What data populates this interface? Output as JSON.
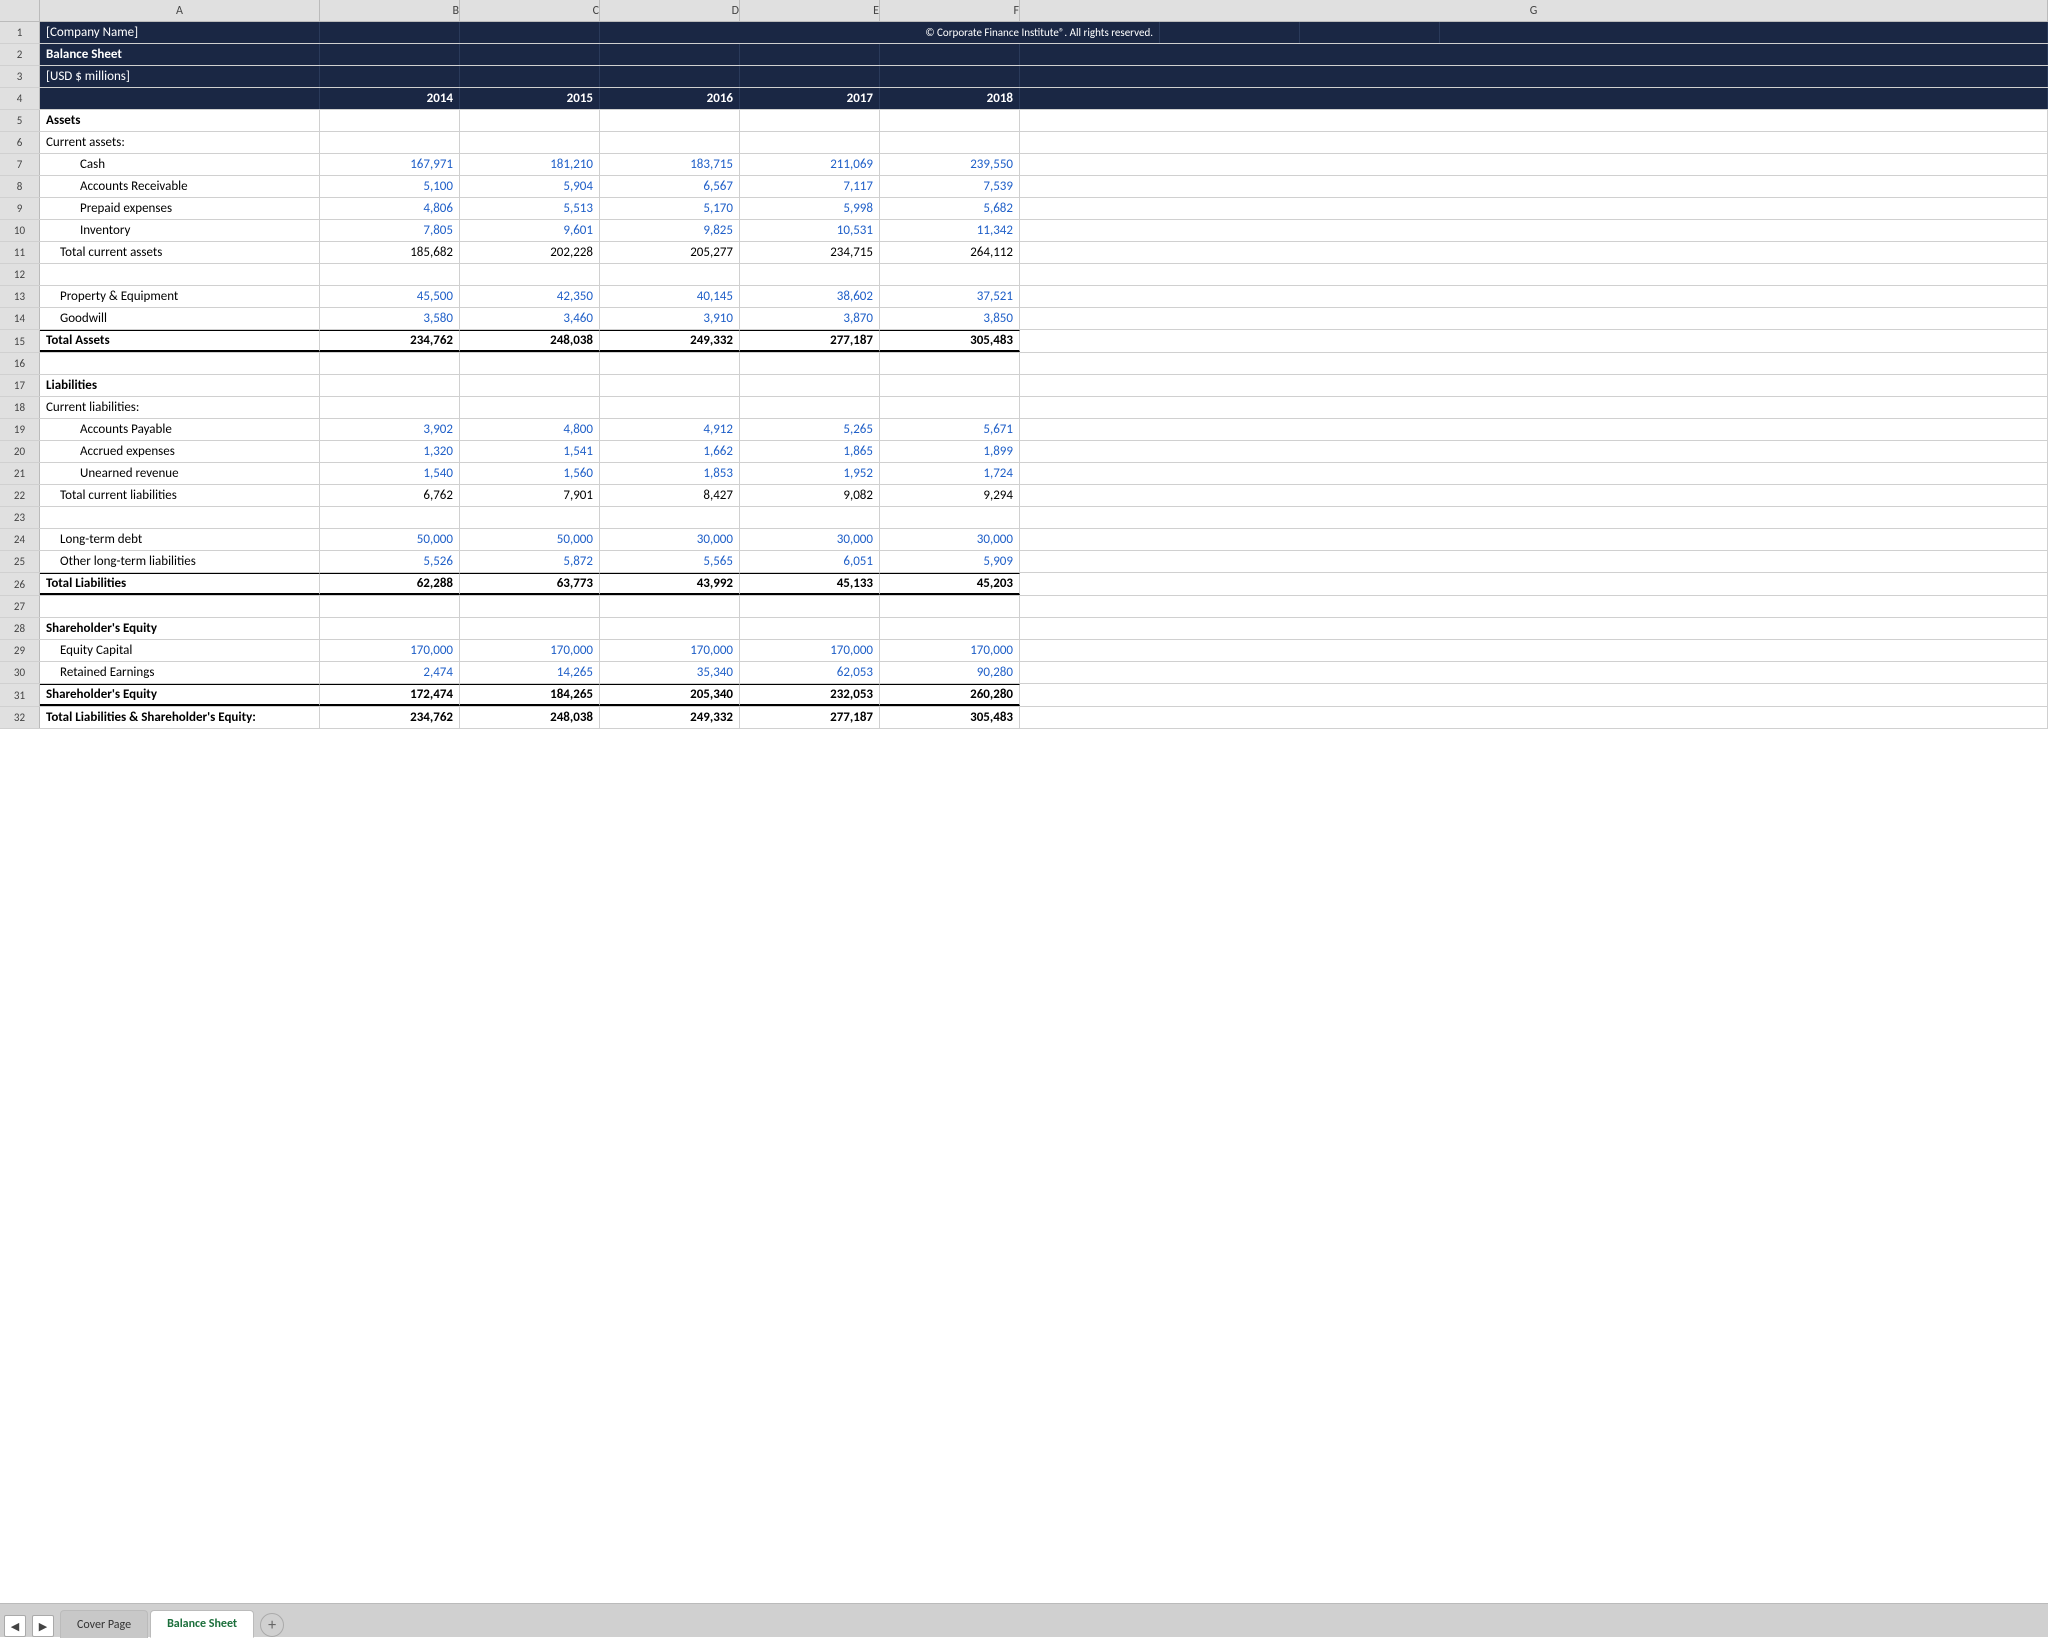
{
  "columns": {
    "headers": [
      "",
      "A",
      "B",
      "C",
      "D",
      "E",
      "F",
      "G"
    ]
  },
  "rows": [
    {
      "num": "1",
      "a": "[Company Name]",
      "b": "",
      "c": "",
      "d": "© Corporate Finance Institute®. All rights reserved.",
      "e": "",
      "f": "",
      "g": "",
      "style": "header-dark",
      "bold": false,
      "copyright": true
    },
    {
      "num": "2",
      "a": "Balance Sheet",
      "b": "",
      "c": "",
      "d": "",
      "e": "",
      "f": "",
      "g": "",
      "style": "header-dark",
      "bold": true
    },
    {
      "num": "3",
      "a": "[USD $ millions]",
      "b": "",
      "c": "",
      "d": "",
      "e": "",
      "f": "",
      "g": "",
      "style": "header-dark",
      "bold": false
    },
    {
      "num": "4",
      "a": "",
      "b": "2014",
      "c": "2015",
      "d": "2016",
      "e": "2017",
      "f": "2018",
      "g": "",
      "style": "year-header",
      "bold": true
    },
    {
      "num": "5",
      "a": "Assets",
      "b": "",
      "c": "",
      "d": "",
      "e": "",
      "f": "",
      "g": "",
      "style": "normal",
      "bold": true
    },
    {
      "num": "6",
      "a": "Current assets:",
      "b": "",
      "c": "",
      "d": "",
      "e": "",
      "f": "",
      "g": "",
      "style": "normal",
      "bold": false
    },
    {
      "num": "7",
      "a": "Cash",
      "b": "167,971",
      "c": "181,210",
      "d": "183,715",
      "e": "211,069",
      "f": "239,550",
      "g": "",
      "style": "normal",
      "blue": true,
      "indent": "indent-2"
    },
    {
      "num": "8",
      "a": "Accounts Receivable",
      "b": "5,100",
      "c": "5,904",
      "d": "6,567",
      "e": "7,117",
      "f": "7,539",
      "g": "",
      "style": "normal",
      "blue": true,
      "indent": "indent-2"
    },
    {
      "num": "9",
      "a": "Prepaid expenses",
      "b": "4,806",
      "c": "5,513",
      "d": "5,170",
      "e": "5,998",
      "f": "5,682",
      "g": "",
      "style": "normal",
      "blue": true,
      "indent": "indent-2"
    },
    {
      "num": "10",
      "a": "Inventory",
      "b": "7,805",
      "c": "9,601",
      "d": "9,825",
      "e": "10,531",
      "f": "11,342",
      "g": "",
      "style": "normal",
      "blue": true,
      "indent": "indent-2"
    },
    {
      "num": "11",
      "a": "Total current assets",
      "b": "185,682",
      "c": "202,228",
      "d": "205,277",
      "e": "234,715",
      "f": "264,112",
      "g": "",
      "style": "subtotal",
      "indent": "indent-1"
    },
    {
      "num": "12",
      "a": "",
      "b": "",
      "c": "",
      "d": "",
      "e": "",
      "f": "",
      "g": "",
      "style": "normal"
    },
    {
      "num": "13",
      "a": "Property & Equipment",
      "b": "45,500",
      "c": "42,350",
      "d": "40,145",
      "e": "38,602",
      "f": "37,521",
      "g": "",
      "style": "normal",
      "blue": true,
      "indent": "indent-1"
    },
    {
      "num": "14",
      "a": "Goodwill",
      "b": "3,580",
      "c": "3,460",
      "d": "3,910",
      "e": "3,870",
      "f": "3,850",
      "g": "",
      "style": "normal",
      "blue": true,
      "indent": "indent-1"
    },
    {
      "num": "15",
      "a": "Total Assets",
      "b": "234,762",
      "c": "248,038",
      "d": "249,332",
      "e": "277,187",
      "f": "305,483",
      "g": "",
      "style": "total",
      "bold": true
    },
    {
      "num": "16",
      "a": "",
      "b": "",
      "c": "",
      "d": "",
      "e": "",
      "f": "",
      "g": "",
      "style": "normal"
    },
    {
      "num": "17",
      "a": "Liabilities",
      "b": "",
      "c": "",
      "d": "",
      "e": "",
      "f": "",
      "g": "",
      "style": "normal",
      "bold": true
    },
    {
      "num": "18",
      "a": "Current liabilities:",
      "b": "",
      "c": "",
      "d": "",
      "e": "",
      "f": "",
      "g": "",
      "style": "normal"
    },
    {
      "num": "19",
      "a": "Accounts Payable",
      "b": "3,902",
      "c": "4,800",
      "d": "4,912",
      "e": "5,265",
      "f": "5,671",
      "g": "",
      "style": "normal",
      "blue": true,
      "indent": "indent-2"
    },
    {
      "num": "20",
      "a": "Accrued expenses",
      "b": "1,320",
      "c": "1,541",
      "d": "1,662",
      "e": "1,865",
      "f": "1,899",
      "g": "",
      "style": "normal",
      "blue": true,
      "indent": "indent-2"
    },
    {
      "num": "21",
      "a": "Unearned revenue",
      "b": "1,540",
      "c": "1,560",
      "d": "1,853",
      "e": "1,952",
      "f": "1,724",
      "g": "",
      "style": "normal",
      "blue": true,
      "indent": "indent-2"
    },
    {
      "num": "22",
      "a": "Total current liabilities",
      "b": "6,762",
      "c": "7,901",
      "d": "8,427",
      "e": "9,082",
      "f": "9,294",
      "g": "",
      "style": "subtotal",
      "indent": "indent-1"
    },
    {
      "num": "23",
      "a": "",
      "b": "",
      "c": "",
      "d": "",
      "e": "",
      "f": "",
      "g": "",
      "style": "normal"
    },
    {
      "num": "24",
      "a": "Long-term debt",
      "b": "50,000",
      "c": "50,000",
      "d": "30,000",
      "e": "30,000",
      "f": "30,000",
      "g": "",
      "style": "normal",
      "blue": true,
      "indent": "indent-1"
    },
    {
      "num": "25",
      "a": "Other long-term liabilities",
      "b": "5,526",
      "c": "5,872",
      "d": "5,565",
      "e": "6,051",
      "f": "5,909",
      "g": "",
      "style": "normal",
      "blue": true,
      "indent": "indent-1"
    },
    {
      "num": "26",
      "a": "Total Liabilities",
      "b": "62,288",
      "c": "63,773",
      "d": "43,992",
      "e": "45,133",
      "f": "45,203",
      "g": "",
      "style": "total",
      "bold": true
    },
    {
      "num": "27",
      "a": "",
      "b": "",
      "c": "",
      "d": "",
      "e": "",
      "f": "",
      "g": "",
      "style": "normal"
    },
    {
      "num": "28",
      "a": "Shareholder's Equity",
      "b": "",
      "c": "",
      "d": "",
      "e": "",
      "f": "",
      "g": "",
      "style": "normal",
      "bold": true
    },
    {
      "num": "29",
      "a": "Equity Capital",
      "b": "170,000",
      "c": "170,000",
      "d": "170,000",
      "e": "170,000",
      "f": "170,000",
      "g": "",
      "style": "normal",
      "blue": true,
      "indent": "indent-1"
    },
    {
      "num": "30",
      "a": "Retained Earnings",
      "b": "2,474",
      "c": "14,265",
      "d": "35,340",
      "e": "62,053",
      "f": "90,280",
      "g": "",
      "style": "normal",
      "blue": true,
      "indent": "indent-1"
    },
    {
      "num": "31",
      "a": "Shareholder's Equity",
      "b": "172,474",
      "c": "184,265",
      "d": "205,340",
      "e": "232,053",
      "f": "260,280",
      "g": "",
      "style": "total",
      "bold": true
    },
    {
      "num": "32",
      "a": "Total Liabilities & Shareholder's Equity:",
      "b": "234,762",
      "c": "248,038",
      "d": "249,332",
      "e": "277,187",
      "f": "305,483",
      "g": "",
      "style": "partial",
      "bold": true
    }
  ],
  "tabs": {
    "items": [
      {
        "label": "Cover Page",
        "active": false
      },
      {
        "label": "Balance Sheet",
        "active": true
      }
    ],
    "add_label": "+"
  },
  "colors": {
    "header_dark": "#1a2744",
    "header_text": "#ffffff",
    "blue_value": "#1f5fc8",
    "tab_active_text": "#1a6e3a"
  }
}
